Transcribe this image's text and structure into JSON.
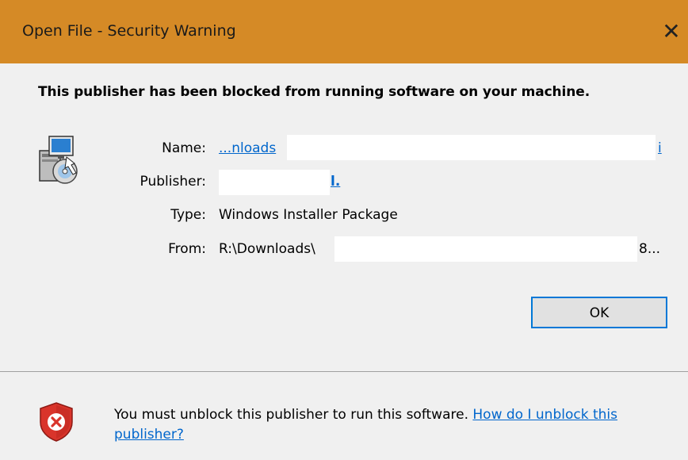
{
  "window": {
    "title": "Open File - Security Warning",
    "close_glyph": "✕"
  },
  "main": {
    "heading": "This publisher has been blocked from running software on your machine.",
    "icon": "installer-package-icon",
    "fields": {
      "name_label": "Name:",
      "name_value_start": "...nloads",
      "name_value_end": "i",
      "publisher_label": "Publisher:",
      "publisher_value_end": "l.",
      "type_label": "Type:",
      "type_value": "Windows Installer Package",
      "from_label": "From:",
      "from_value_start": "R:\\Downloads\\",
      "from_value_end": "8..."
    },
    "ok_label": "OK"
  },
  "footer": {
    "icon": "shield-error-icon",
    "message": "You must unblock this publisher to run this software.",
    "link_text": "How do I unblock this publisher?"
  },
  "colors": {
    "titlebar": "#d58a26",
    "link": "#0066cc",
    "ok_border": "#0078d7",
    "shield_red": "#d9342b"
  }
}
